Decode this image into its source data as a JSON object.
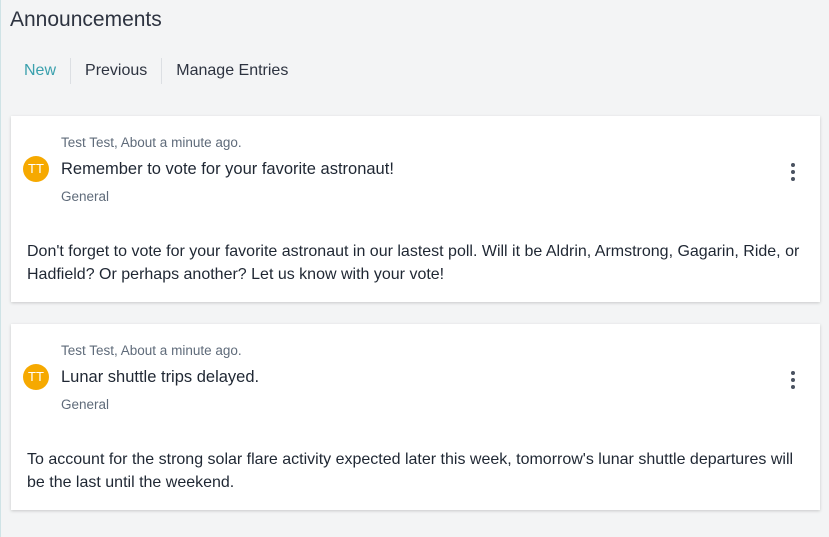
{
  "page": {
    "title": "Announcements"
  },
  "tabs": [
    {
      "label": "New"
    },
    {
      "label": "Previous"
    },
    {
      "label": "Manage Entries"
    }
  ],
  "colors": {
    "accent": "#3aa0ad",
    "avatar": "#f6a900",
    "card": "#ffffff"
  },
  "announcements": [
    {
      "author_time": "Test Test, About a minute ago.",
      "initials": "TT",
      "title": "Remember to vote for your favorite astronaut!",
      "category": "General",
      "body": "Don't forget to vote for your favorite astronaut in our lastest poll. Will it be Aldrin, Armstrong, Gagarin, Ride, or Hadfield? Or perhaps another? Let us know with your vote!",
      "menu_icon": "more-vertical-icon"
    },
    {
      "author_time": "Test Test, About a minute ago.",
      "initials": "TT",
      "title": "Lunar shuttle trips delayed.",
      "category": "General",
      "body": "To account for the strong solar flare activity expected later this week, tomorrow's lunar shuttle departures will be the last until the weekend.",
      "menu_icon": "more-vertical-icon"
    }
  ]
}
